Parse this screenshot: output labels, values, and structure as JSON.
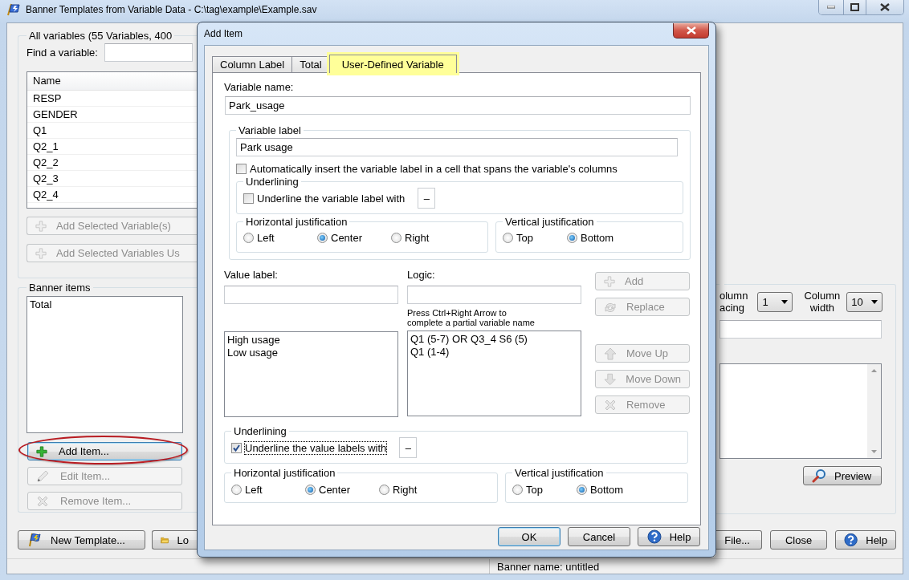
{
  "window": {
    "title": "Banner Templates from Variable Data - C:\\tag\\example\\Example.sav"
  },
  "variables": {
    "heading": "All variables  (55 Variables, 400",
    "find_label": "Find a variable:",
    "columns": [
      "Name"
    ],
    "rows": [
      "RESP",
      "GENDER",
      "Q1",
      "Q2_1",
      "Q2_2",
      "Q2_3",
      "Q2_4"
    ],
    "buttons": [
      {
        "label": "Add Selected Variable(s)",
        "kind": "add",
        "disabled": true
      },
      {
        "label": "Add Selected Variables Us",
        "kind": "add",
        "disabled": true
      }
    ]
  },
  "banner_items": {
    "heading": "Banner items",
    "items": [
      "Total"
    ],
    "buttons": [
      {
        "label": "Add Item...",
        "kind": "add",
        "disabled": false,
        "highlighted": true
      },
      {
        "label": "Edit Item...",
        "kind": "edit",
        "disabled": true,
        "highlighted": false
      },
      {
        "label": "Remove Item...",
        "kind": "remove",
        "disabled": true,
        "highlighted": false
      }
    ]
  },
  "layout": {
    "spacing_label": [
      "olumn",
      "acing"
    ],
    "spacing_value": "1",
    "width_label": [
      "Column",
      "width"
    ],
    "width_value": "10",
    "preview_button": {
      "label": "Preview",
      "kind": "preview"
    }
  },
  "footer_buttons": [
    {
      "label": "New Template...",
      "kind": "new"
    },
    {
      "label": "Lo",
      "kind": "open"
    }
  ],
  "footer_buttons_right": [
    {
      "label": "File...",
      "kind": "plain"
    },
    {
      "label": "Close",
      "kind": "plain"
    },
    {
      "label": "Help",
      "kind": "help"
    }
  ],
  "status_bar": {
    "text": "Banner name: untitled"
  },
  "dialog": {
    "title": "Add Item",
    "tabs": [
      {
        "label": "Column Label",
        "selected": false,
        "highlighted": false
      },
      {
        "label": "Total",
        "selected": false,
        "highlighted": false
      },
      {
        "label": "User-Defined Variable",
        "selected": true,
        "highlighted": true
      }
    ],
    "variable_name": {
      "label": "Variable name:",
      "value": "Park_usage"
    },
    "variable_label": {
      "heading": "Variable label",
      "value": "Park usage",
      "auto_insert": {
        "label": "Automatically insert the variable label in a cell that spans the variable's columns",
        "checked": false
      },
      "underlining": {
        "heading": "Underlining",
        "label": "Underline the variable label with",
        "checked": false,
        "character": "–"
      },
      "horizontal": {
        "heading": "Horizontal justification",
        "options": [
          {
            "label": "Left",
            "selected": false
          },
          {
            "label": "Center",
            "selected": true
          },
          {
            "label": "Right",
            "selected": false
          }
        ]
      },
      "vertical": {
        "heading": "Vertical justification",
        "options": [
          {
            "label": "Top",
            "selected": false
          },
          {
            "label": "Bottom",
            "selected": true
          }
        ]
      }
    },
    "value_label": {
      "label": "Value label:"
    },
    "logic": {
      "label": "Logic:",
      "hint_lines": [
        "Press Ctrl+Right Arrow to",
        "complete a partial variable name"
      ]
    },
    "value_labels": [
      "High usage",
      "Low usage"
    ],
    "logic_items": [
      "Q1 (5-7) OR Q3_4 S6 (5)",
      "Q1 (1-4)"
    ],
    "side_buttons": [
      {
        "label": "Add",
        "kind": "add",
        "disabled": true
      },
      {
        "label": "Replace",
        "kind": "replace",
        "disabled": true
      },
      {
        "label": "Move Up",
        "kind": "up",
        "disabled": true
      },
      {
        "label": "Move Down",
        "kind": "down",
        "disabled": true
      },
      {
        "label": "Remove",
        "kind": "remove",
        "disabled": true
      }
    ],
    "value_underlining": {
      "heading": "Underlining",
      "label": "Underline the value labels with",
      "checked": true,
      "character": "–"
    },
    "horizontal": {
      "heading": "Horizontal justification",
      "options": [
        {
          "label": "Left",
          "selected": false
        },
        {
          "label": "Center",
          "selected": true
        },
        {
          "label": "Right",
          "selected": false
        }
      ]
    },
    "vertical": {
      "heading": "Vertical justification",
      "options": [
        {
          "label": "Top",
          "selected": false
        },
        {
          "label": "Bottom",
          "selected": true
        }
      ]
    },
    "buttons": [
      {
        "label": "OK",
        "kind": "plain",
        "default": true
      },
      {
        "label": "Cancel",
        "kind": "plain",
        "default": false
      },
      {
        "label": "Help",
        "kind": "help",
        "default": false
      }
    ]
  }
}
